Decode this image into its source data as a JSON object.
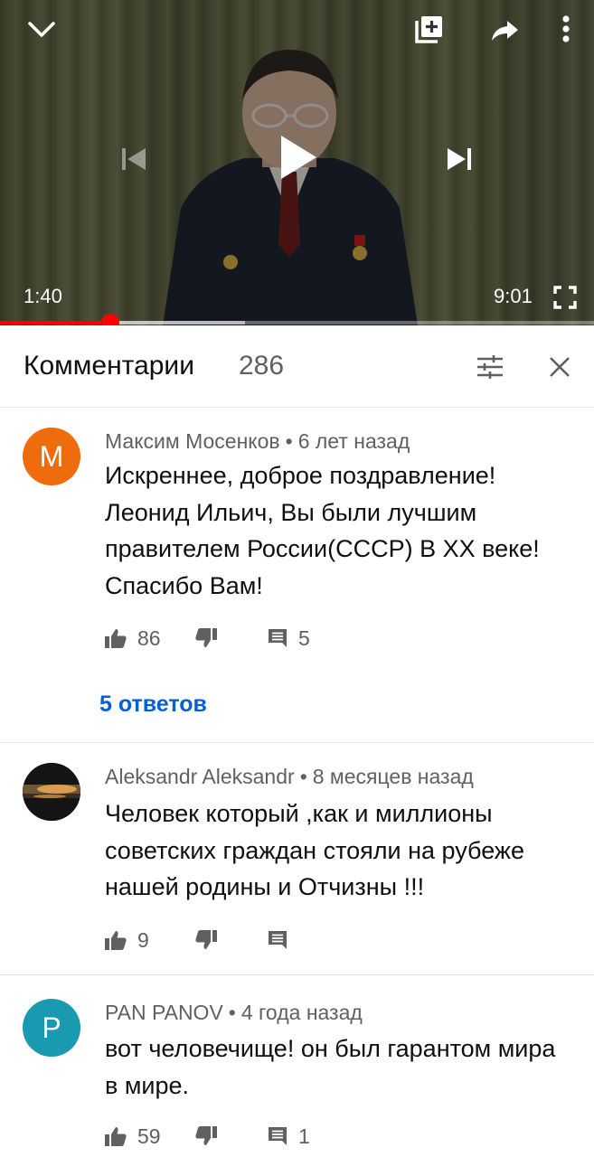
{
  "player": {
    "current_time": "1:40",
    "duration": "9:01",
    "progress_fraction": 0.185,
    "buffered_fraction": 0.413,
    "colors": {
      "progress": "#ff0000"
    }
  },
  "comments_panel": {
    "title": "Комментарии",
    "count": "286"
  },
  "comments": [
    {
      "avatar_letter": "M",
      "avatar_color": "#ee6c0b",
      "author": "Максим Мосенков",
      "age": "6 лет назад",
      "text": "Искреннее, доброе поздравление! Леонид Ильич, Вы были лучшим правителем России(СССР) В ХХ веке! Спасибо Вам!",
      "likes": "86",
      "reply_count": "5",
      "replies_link": "5 ответов"
    },
    {
      "avatar_letter": "",
      "avatar_color": "#1a1a1a",
      "author": "Aleksandr Aleksandr",
      "age": "8 месяцев назад",
      "text": "Человек который ,как и миллионы советских граждан стояли на рубеже нашей родины и Отчизны !!!",
      "likes": "9",
      "reply_count": ""
    },
    {
      "avatar_letter": "P",
      "avatar_color": "#1a9ab0",
      "author": "PAN PANOV",
      "age": "4 года назад",
      "text": "вот человечище! он был гарантом мира в мире.",
      "likes": "59",
      "reply_count": "1"
    }
  ],
  "icons": {
    "collapse": "chevron-down-icon",
    "add_to_playlist": "playlist-add-icon",
    "share": "share-icon",
    "more": "more-vert-icon",
    "previous": "skip-previous-icon",
    "play": "play-icon",
    "next": "skip-next-icon",
    "fullscreen": "fullscreen-icon",
    "sort": "sort-icon",
    "close": "close-icon",
    "like": "thumb-up-icon",
    "dislike": "thumb-down-icon",
    "reply": "comment-icon"
  }
}
